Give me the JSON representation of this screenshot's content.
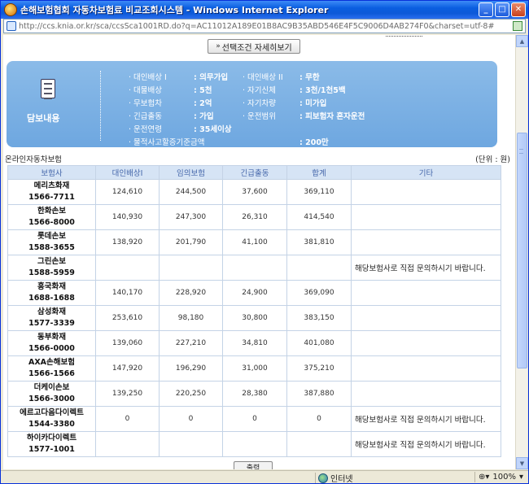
{
  "window": {
    "title": "손해보험협회 자동차보험료 비교조회시스템 - Windows Internet Explorer",
    "url": "http://ccs.knia.or.kr/sca/ccsSca1001RD.do?q=AC11012A189E01B8AC9B35ABD546E4F5C9006D4AB274F0&charset=utf-8#"
  },
  "toolbar": {
    "detail_button": "선택조건 자세히보기"
  },
  "summary": {
    "label": "담보내용",
    "col1": [
      {
        "k": "대인배상 I",
        "v": ": 의무가입"
      },
      {
        "k": "대물배상",
        "v": ": 5천"
      },
      {
        "k": "무보험차",
        "v": ": 2억"
      },
      {
        "k": "긴급출동",
        "v": ": 가입"
      },
      {
        "k": "운전연령",
        "v": ": 35세이상"
      },
      {
        "k": "물적사고할증기준금액",
        "v": ": 200만"
      }
    ],
    "col2": [
      {
        "k": "대인배상 II",
        "v": ": 무한"
      },
      {
        "k": "자기신체",
        "v": ": 3천/1천5백"
      },
      {
        "k": "자기차량",
        "v": ": 미가입"
      },
      {
        "k": "운전범위",
        "v": ": 피보험자 혼자운전"
      }
    ]
  },
  "section": {
    "title": "온라인자동차보험",
    "unit": "(단위 : 원)"
  },
  "table": {
    "headers": [
      "보험사",
      "대인배상I",
      "임의보험",
      "긴급출동",
      "합계",
      "기타"
    ],
    "rows": [
      {
        "name": "메리츠화재",
        "phone": "1566-7711",
        "c1": "124,610",
        "c2": "244,500",
        "c3": "37,600",
        "c4": "369,110",
        "note": ""
      },
      {
        "name": "한화손보",
        "phone": "1566-8000",
        "c1": "140,930",
        "c2": "247,300",
        "c3": "26,310",
        "c4": "414,540",
        "note": ""
      },
      {
        "name": "롯데손보",
        "phone": "1588-3655",
        "c1": "138,920",
        "c2": "201,790",
        "c3": "41,100",
        "c4": "381,810",
        "note": ""
      },
      {
        "name": "그린손보",
        "phone": "1588-5959",
        "c1": "",
        "c2": "",
        "c3": "",
        "c4": "",
        "note": "해당보험사로 직접 문의하시기 바랍니다."
      },
      {
        "name": "흥국화재",
        "phone": "1688-1688",
        "c1": "140,170",
        "c2": "228,920",
        "c3": "24,900",
        "c4": "369,090",
        "note": ""
      },
      {
        "name": "삼성화재",
        "phone": "1577-3339",
        "c1": "253,610",
        "c2": "98,180",
        "c3": "30,800",
        "c4": "383,150",
        "note": ""
      },
      {
        "name": "동부화재",
        "phone": "1566-0000",
        "c1": "139,060",
        "c2": "227,210",
        "c3": "34,810",
        "c4": "401,080",
        "note": ""
      },
      {
        "name": "AXA손해보험",
        "phone": "1566-1566",
        "c1": "147,920",
        "c2": "196,290",
        "c3": "31,000",
        "c4": "375,210",
        "note": ""
      },
      {
        "name": "더케이손보",
        "phone": "1566-3000",
        "c1": "139,250",
        "c2": "220,250",
        "c3": "28,380",
        "c4": "387,880",
        "note": ""
      },
      {
        "name": "에르고다음다이렉트",
        "phone": "1544-3380",
        "c1": "0",
        "c2": "0",
        "c3": "0",
        "c4": "0",
        "note": "해당보험사로 직접 문의하시기 바랍니다."
      },
      {
        "name": "하이카다이렉트",
        "phone": "1577-1001",
        "c1": "",
        "c2": "",
        "c3": "",
        "c4": "",
        "note": "해당보험사로 직접 문의하시기 바랍니다."
      }
    ]
  },
  "bottom_button": "출력",
  "status": {
    "zone": "인터넷",
    "zoom": "100%"
  }
}
